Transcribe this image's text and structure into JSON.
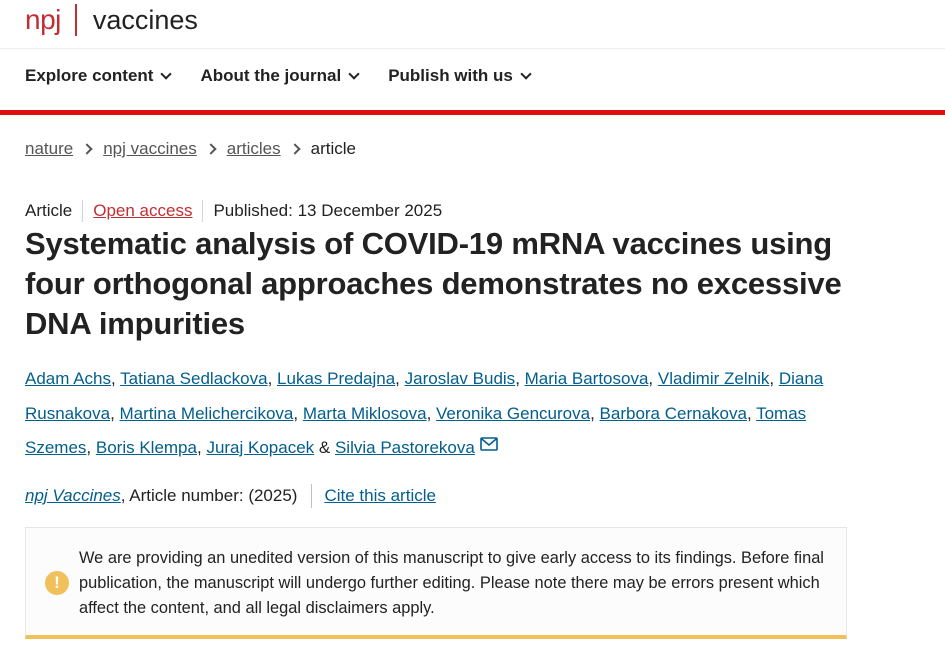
{
  "header": {
    "logo_npj": "npj",
    "logo_title": "vaccines",
    "nav": [
      "Explore content",
      "About the journal",
      "Publish with us"
    ]
  },
  "breadcrumb": [
    "nature",
    "npj vaccines",
    "articles",
    "article"
  ],
  "article": {
    "type": "Article",
    "access": "Open access",
    "published": "Published: 13 December 2025",
    "title": "Systematic analysis of COVID-19 mRNA vaccines using four orthogonal approaches demonstrates no excessive DNA impurities",
    "authors": [
      "Adam Achs",
      "Tatiana Sedlackova",
      "Lukas Predajna",
      "Jaroslav Budis",
      "Maria Bartosova",
      "Vladimir Zelnik",
      "Diana Rusnakova",
      "Martina Melichercikova",
      "Marta Miklosova",
      "Veronika Gencurova",
      "Barbora Cernakova",
      "Tomas Szemes",
      "Boris Klempa",
      "Juraj Kopacek",
      "Silvia Pastorekova"
    ],
    "author_sep": ", ",
    "author_and": " & ",
    "journal": "npj Vaccines",
    "article_number": ", Article number:  (2025)",
    "cite": "Cite this article"
  },
  "notice": {
    "icon": "warning-icon",
    "text": "We are providing an unedited version of this manuscript to give early access to its findings. Before final publication, the manuscript will undergo further editing. Please note there may be errors present which affect the content, and all legal disclaimers apply."
  },
  "colors": {
    "brand_red": "#c42e33",
    "nav_bar_red": "#e00e0e",
    "link_blue": "#025e8d",
    "notice_accent": "#f0c15a"
  }
}
